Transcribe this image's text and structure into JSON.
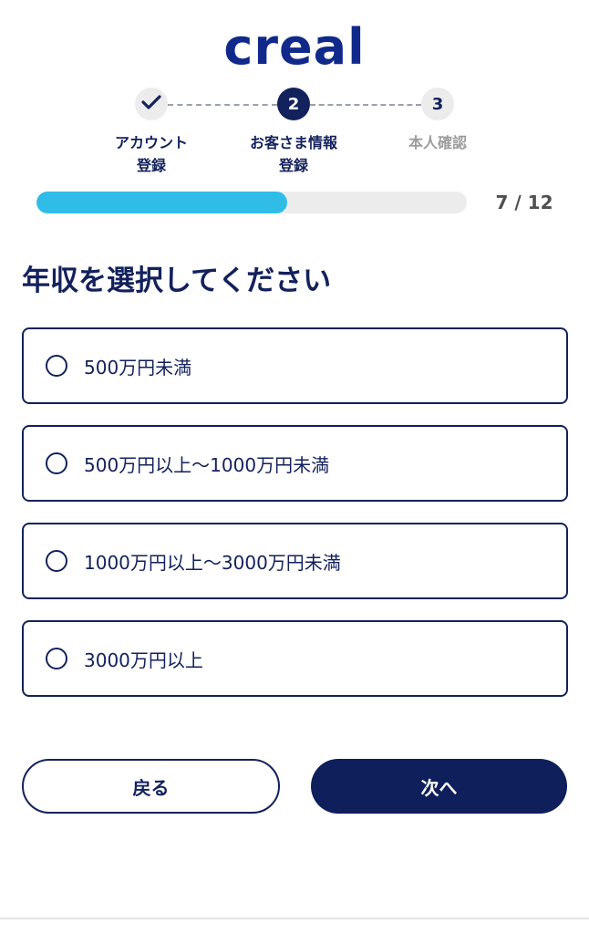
{
  "brand": {
    "logo_text": "creal",
    "color": "#10298a"
  },
  "steps": [
    {
      "number": "",
      "label_line1": "アカウント",
      "label_line2": "登録",
      "state": "done",
      "icon": "check-icon"
    },
    {
      "number": "2",
      "label_line1": "お客さま情報",
      "label_line2": "登録",
      "state": "active"
    },
    {
      "number": "3",
      "label_line1": "本人確認",
      "label_line2": "",
      "state": "todo"
    }
  ],
  "progress": {
    "current": 7,
    "total": 12,
    "fraction": 0.583,
    "label": "7 / 12",
    "color": "#2fbde8"
  },
  "question": {
    "title": "年収を選択してください"
  },
  "options": [
    {
      "label": "500万円未満",
      "selected": false
    },
    {
      "label": "500万円以上〜1000万円未満",
      "selected": false
    },
    {
      "label": "1000万円以上〜3000万円未満",
      "selected": false
    },
    {
      "label": "3000万円以上",
      "selected": false
    }
  ],
  "buttons": {
    "back_label": "戻る",
    "next_label": "次へ"
  },
  "colors": {
    "navy": "#13215c",
    "muted": "#9c9c9c"
  }
}
